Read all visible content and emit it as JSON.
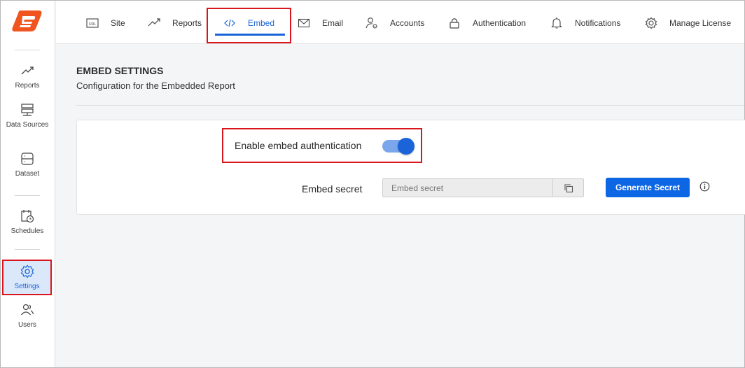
{
  "sidebar": {
    "items": [
      {
        "label": "Reports",
        "icon": "trend-icon"
      },
      {
        "label": "Data Sources",
        "icon": "server-icon"
      },
      {
        "label": "Dataset",
        "icon": "dataset-icon"
      },
      {
        "label": "Schedules",
        "icon": "calendar-clock-icon"
      },
      {
        "label": "Settings",
        "icon": "gear-icon",
        "active": true
      },
      {
        "label": "Users",
        "icon": "users-icon"
      }
    ]
  },
  "topnav": {
    "tabs": [
      {
        "label": "Site",
        "icon": "url-icon"
      },
      {
        "label": "Reports",
        "icon": "trend-icon"
      },
      {
        "label": "Embed",
        "icon": "code-icon",
        "active": true
      },
      {
        "label": "Email",
        "icon": "mail-icon"
      },
      {
        "label": "Accounts",
        "icon": "user-gear-icon"
      },
      {
        "label": "Authentication",
        "icon": "lock-icon"
      },
      {
        "label": "Notifications",
        "icon": "bell-icon"
      },
      {
        "label": "Manage License",
        "icon": "license-gear-icon"
      }
    ]
  },
  "header": {
    "title": "EMBED SETTINGS",
    "subtitle": "Configuration for the Embedded Report"
  },
  "form": {
    "auth_label": "Enable embed authentication",
    "auth_enabled": true,
    "secret_label": "Embed secret",
    "secret_placeholder": "Embed secret",
    "secret_value": "",
    "generate_label": "Generate Secret"
  },
  "colors": {
    "accent": "#1a63d9",
    "highlight": "#d9161d",
    "logo": "#f0541f"
  }
}
